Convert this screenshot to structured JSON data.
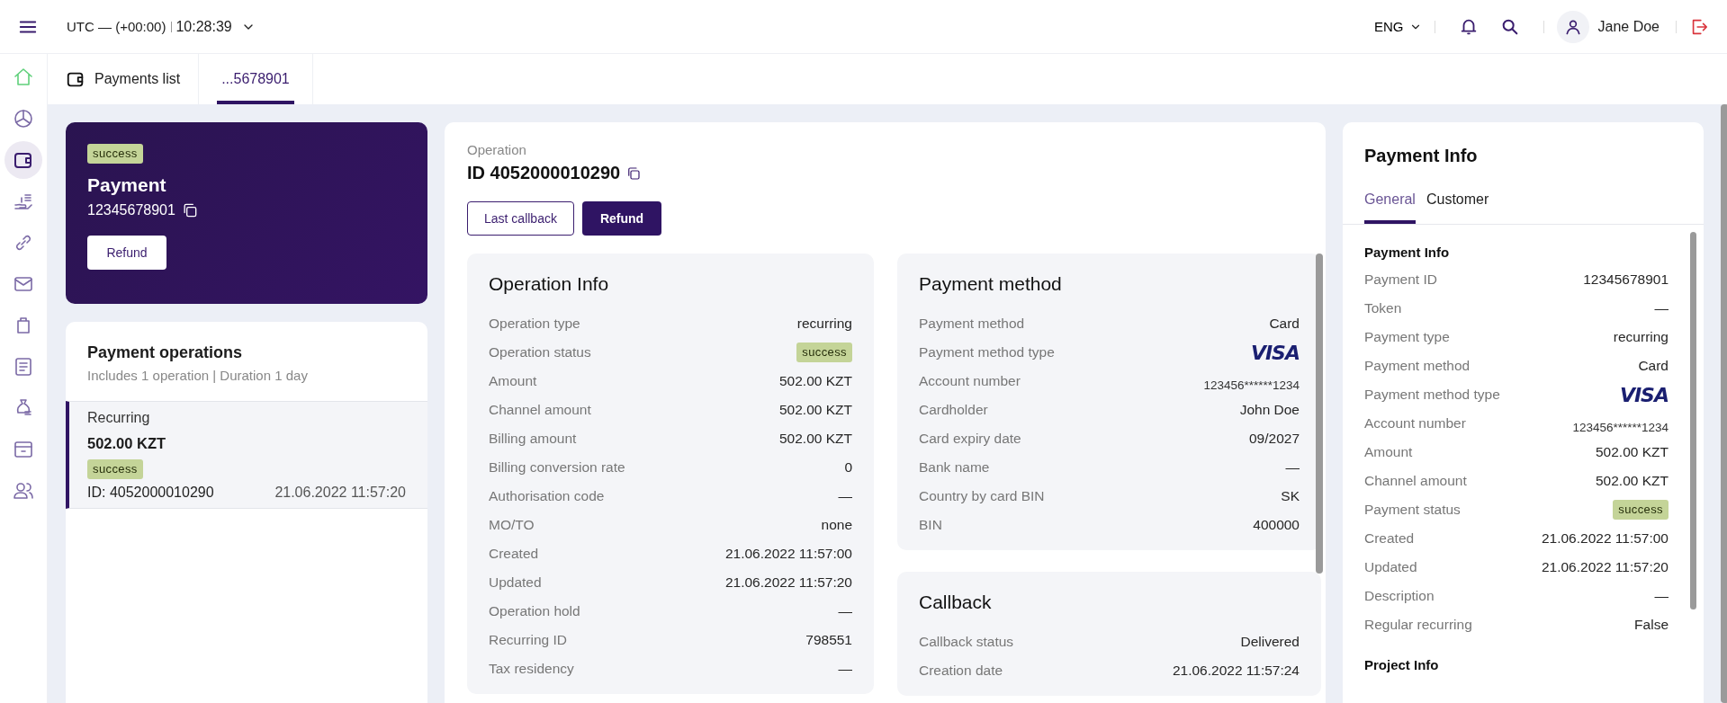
{
  "topbar": {
    "timezone": "UTC — (+00:00)",
    "time": "10:28:39",
    "language": "ENG",
    "user": "Jane Doe"
  },
  "sidebar": {
    "items": [
      {
        "kind": "home",
        "selected": false
      },
      {
        "kind": "chart",
        "selected": false
      },
      {
        "kind": "wallet",
        "selected": true
      },
      {
        "kind": "cash",
        "selected": false
      },
      {
        "kind": "link",
        "selected": false
      },
      {
        "kind": "mail",
        "selected": false
      },
      {
        "kind": "bag",
        "selected": false
      },
      {
        "kind": "document",
        "selected": false
      },
      {
        "kind": "moneybag",
        "selected": false
      },
      {
        "kind": "archive",
        "selected": false
      },
      {
        "kind": "users",
        "selected": false
      }
    ]
  },
  "tabs": [
    {
      "label": "Payments list",
      "kind": "list",
      "selected": false
    },
    {
      "label": "...5678901",
      "kind": "detail",
      "selected": true
    }
  ],
  "payment": {
    "status": "success",
    "title": "Payment",
    "number": "12345678901",
    "button": "Refund"
  },
  "operations": {
    "title": "Payment operations",
    "subtitle": "Includes 1 operation | Duration 1 day",
    "items": [
      {
        "type": "Recurring",
        "amount": "502.00 KZT",
        "status": "success",
        "id": "ID: 4052000010290",
        "date": "21.06.2022 11:57:20",
        "selected": true
      }
    ]
  },
  "operation": {
    "caption": "Operation",
    "id": "ID 4052000010290",
    "buttons": [
      {
        "label": "Last callback",
        "kind": "outline"
      },
      {
        "label": "Refund",
        "kind": "primary"
      }
    ],
    "columns": [
      [
        {
          "title": "Operation Info",
          "rows": [
            {
              "label": "Operation type",
              "value": "recurring",
              "kind": "text"
            },
            {
              "label": "Operation status",
              "value": "success",
              "kind": "badge"
            },
            {
              "label": "Amount",
              "value": "502.00 KZT",
              "kind": "text"
            },
            {
              "label": "Channel amount",
              "value": "502.00 KZT",
              "kind": "text"
            },
            {
              "label": "Billing amount",
              "value": "502.00 KZT",
              "kind": "text"
            },
            {
              "label": "Billing conversion rate",
              "value": "0",
              "kind": "text"
            },
            {
              "label": "Authorisation code",
              "value": "—",
              "kind": "text"
            },
            {
              "label": "MO/TO",
              "value": "none",
              "kind": "text"
            },
            {
              "label": "Created",
              "value": "21.06.2022 11:57:00",
              "kind": "text"
            },
            {
              "label": "Updated",
              "value": "21.06.2022 11:57:20",
              "kind": "text"
            },
            {
              "label": "Operation hold",
              "value": "—",
              "kind": "text"
            },
            {
              "label": "Recurring ID",
              "value": "798551",
              "kind": "text"
            },
            {
              "label": "Tax residency",
              "value": "—",
              "kind": "text"
            }
          ]
        }
      ],
      [
        {
          "title": "Payment method",
          "rows": [
            {
              "label": "Payment method",
              "value": "Card",
              "kind": "text"
            },
            {
              "label": "Payment method type",
              "value": "VISA",
              "kind": "brand"
            },
            {
              "label": "Account number",
              "value": "123456******1234",
              "kind": "small"
            },
            {
              "label": "Cardholder",
              "value": "John Doe",
              "kind": "text"
            },
            {
              "label": "Card expiry date",
              "value": "09/2027",
              "kind": "text"
            },
            {
              "label": "Bank name",
              "value": "—",
              "kind": "text"
            },
            {
              "label": "Country by card BIN",
              "value": "SK",
              "kind": "text"
            },
            {
              "label": "BIN",
              "value": "400000",
              "kind": "text"
            }
          ]
        },
        {
          "title": "Callback",
          "rows": [
            {
              "label": "Callback status",
              "value": "Delivered",
              "kind": "text"
            },
            {
              "label": "Creation date",
              "value": "21.06.2022 11:57:24",
              "kind": "text"
            }
          ]
        }
      ]
    ]
  },
  "info": {
    "title": "Payment Info",
    "tabs": [
      {
        "label": "General",
        "selected": true
      },
      {
        "label": "Customer",
        "selected": false
      }
    ],
    "groups": [
      {
        "title": "Payment Info",
        "rows": [
          {
            "label": "Payment ID",
            "value": "12345678901",
            "kind": "text"
          },
          {
            "label": "Token",
            "value": "—",
            "kind": "text"
          },
          {
            "label": "Payment type",
            "value": "recurring",
            "kind": "text"
          },
          {
            "label": "Payment method",
            "value": "Card",
            "kind": "text"
          },
          {
            "label": "Payment method type",
            "value": "VISA",
            "kind": "brand"
          },
          {
            "label": "Account number",
            "value": "123456******1234",
            "kind": "small"
          },
          {
            "label": "Amount",
            "value": "502.00 KZT",
            "kind": "text"
          },
          {
            "label": "Channel amount",
            "value": "502.00 KZT",
            "kind": "text"
          },
          {
            "label": "Payment status",
            "value": "success",
            "kind": "badge"
          },
          {
            "label": "Created",
            "value": "21.06.2022 11:57:00",
            "kind": "text"
          },
          {
            "label": "Updated",
            "value": "21.06.2022 11:57:20",
            "kind": "text"
          },
          {
            "label": "Description",
            "value": "—",
            "kind": "text"
          },
          {
            "label": "Regular recurring",
            "value": "False",
            "kind": "text"
          }
        ]
      },
      {
        "title": "Project Info"
      }
    ]
  }
}
